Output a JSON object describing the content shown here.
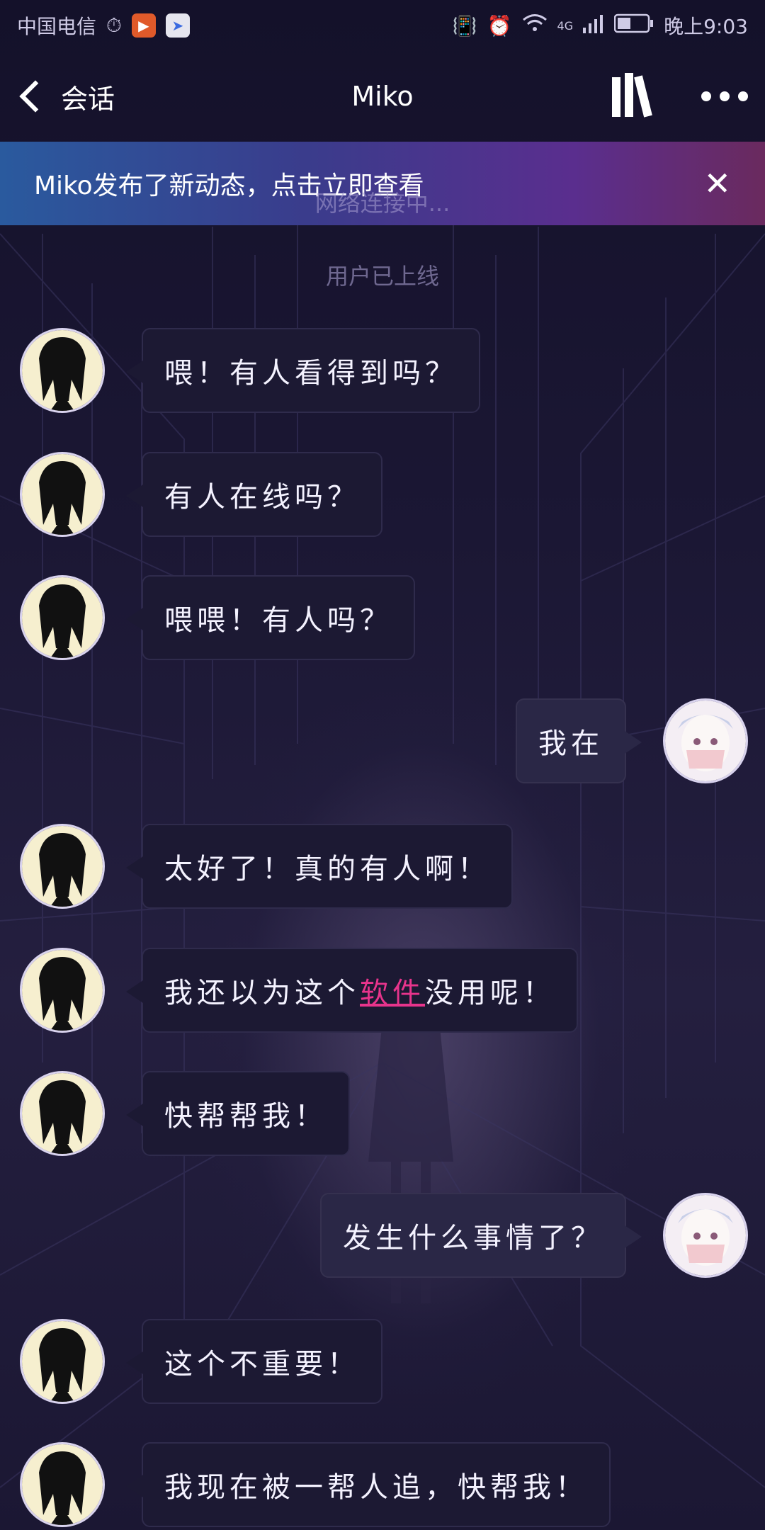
{
  "status_bar": {
    "carrier": "中国电信",
    "time": "晚上9:03",
    "network": "4G",
    "icons": [
      "timer-icon",
      "video-app-icon",
      "browser-app-icon",
      "vibrate-icon",
      "alarm-icon",
      "wifi-icon",
      "signal-icon",
      "battery-icon"
    ]
  },
  "nav": {
    "back_label": "会话",
    "title": "Miko",
    "icons": [
      "back-chevron-icon",
      "library-icon",
      "more-icon"
    ]
  },
  "banner": {
    "text": "Miko发布了新动态，点击立即查看",
    "close_symbol": "✕"
  },
  "overlay_connecting": "网络连接中...",
  "system_message": "用户已上线",
  "messages": [
    {
      "side": "left",
      "text": "喂！有人看得到吗？"
    },
    {
      "side": "left",
      "text": "有人在线吗？"
    },
    {
      "side": "left",
      "text": "喂喂！有人吗？"
    },
    {
      "side": "right",
      "text": "我在"
    },
    {
      "side": "left",
      "text": "太好了！真的有人啊！"
    },
    {
      "side": "left",
      "pre": "我还以为这个",
      "highlight": "软件",
      "post": "没用呢！"
    },
    {
      "side": "left",
      "text": "快帮帮我！"
    },
    {
      "side": "right",
      "text": "发生什么事情了？"
    },
    {
      "side": "left",
      "text": "这个不重要！"
    },
    {
      "side": "left",
      "text": "我现在被一帮人追，快帮我！"
    }
  ],
  "colors": {
    "background": "#17142b",
    "bubble_left": "#1c1933",
    "bubble_right": "#2a2746",
    "highlight": "#e8348c",
    "banner_start": "#2a5a9e",
    "banner_end": "#6a2a5e"
  }
}
